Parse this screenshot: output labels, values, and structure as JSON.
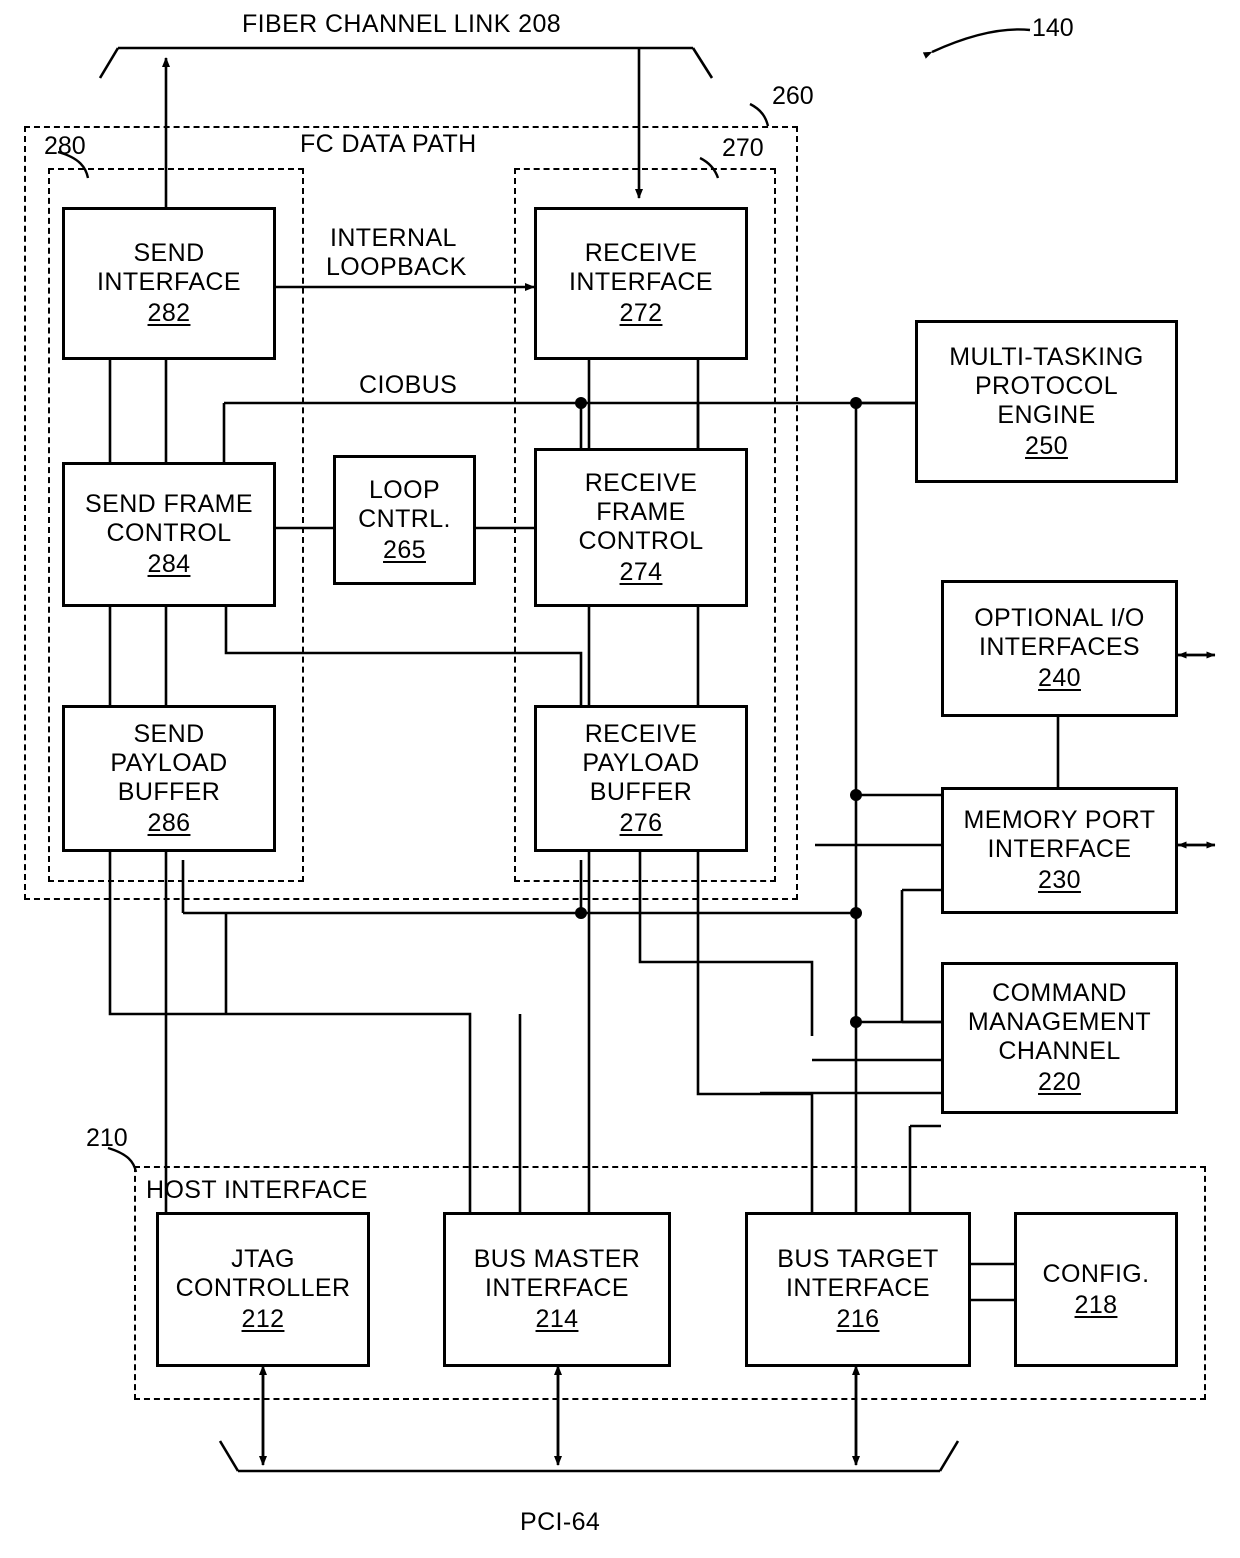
{
  "figure": {
    "ref_number": "140",
    "bus_top_label": "FIBER CHANNEL LINK 208",
    "bus_bottom_label": "PCI-64"
  },
  "groups": {
    "fc_data_path": {
      "label": "FC DATA PATH",
      "ref": "260"
    },
    "send_path": {
      "label": "",
      "ref": "280"
    },
    "receive_path": {
      "label": "",
      "ref": "270"
    },
    "host_interface": {
      "label": "HOST INTERFACE",
      "ref": "210"
    }
  },
  "labels": {
    "internal_loopback_l1": "INTERNAL",
    "internal_loopback_l2": "LOOPBACK",
    "ciobus": "CIOBUS"
  },
  "blocks": [
    {
      "id": "send_interface",
      "lines": [
        "SEND",
        "INTERFACE"
      ],
      "num": "282"
    },
    {
      "id": "recv_interface",
      "lines": [
        "RECEIVE",
        "INTERFACE"
      ],
      "num": "272"
    },
    {
      "id": "send_frame_ctrl",
      "lines": [
        "SEND FRAME",
        "CONTROL"
      ],
      "num": "284"
    },
    {
      "id": "loop_cntrl",
      "lines": [
        "LOOP",
        "CNTRL."
      ],
      "num": "265"
    },
    {
      "id": "recv_frame_ctrl",
      "lines": [
        "RECEIVE",
        "FRAME",
        "CONTROL"
      ],
      "num": "274"
    },
    {
      "id": "send_payload",
      "lines": [
        "SEND",
        "PAYLOAD",
        "BUFFER"
      ],
      "num": "286"
    },
    {
      "id": "recv_payload",
      "lines": [
        "RECEIVE",
        "PAYLOAD",
        "BUFFER"
      ],
      "num": "276"
    },
    {
      "id": "mtpe",
      "lines": [
        "MULTI-TASKING",
        "PROTOCOL",
        "ENGINE"
      ],
      "num": "250"
    },
    {
      "id": "optional_io",
      "lines": [
        "OPTIONAL I/O",
        "INTERFACES"
      ],
      "num": "240"
    },
    {
      "id": "memory_port",
      "lines": [
        "MEMORY PORT",
        "INTERFACE"
      ],
      "num": "230"
    },
    {
      "id": "cmd_mgmt",
      "lines": [
        "COMMAND",
        "MANAGEMENT",
        "CHANNEL"
      ],
      "num": "220"
    },
    {
      "id": "jtag",
      "lines": [
        "JTAG",
        "CONTROLLER"
      ],
      "num": "212"
    },
    {
      "id": "bus_master",
      "lines": [
        "BUS MASTER",
        "INTERFACE"
      ],
      "num": "214"
    },
    {
      "id": "bus_target",
      "lines": [
        "BUS TARGET",
        "INTERFACE"
      ],
      "num": "216"
    },
    {
      "id": "config",
      "lines": [
        "CONFIG."
      ],
      "num": "218"
    }
  ],
  "colors": {
    "line": "#000000",
    "background": "#ffffff"
  }
}
